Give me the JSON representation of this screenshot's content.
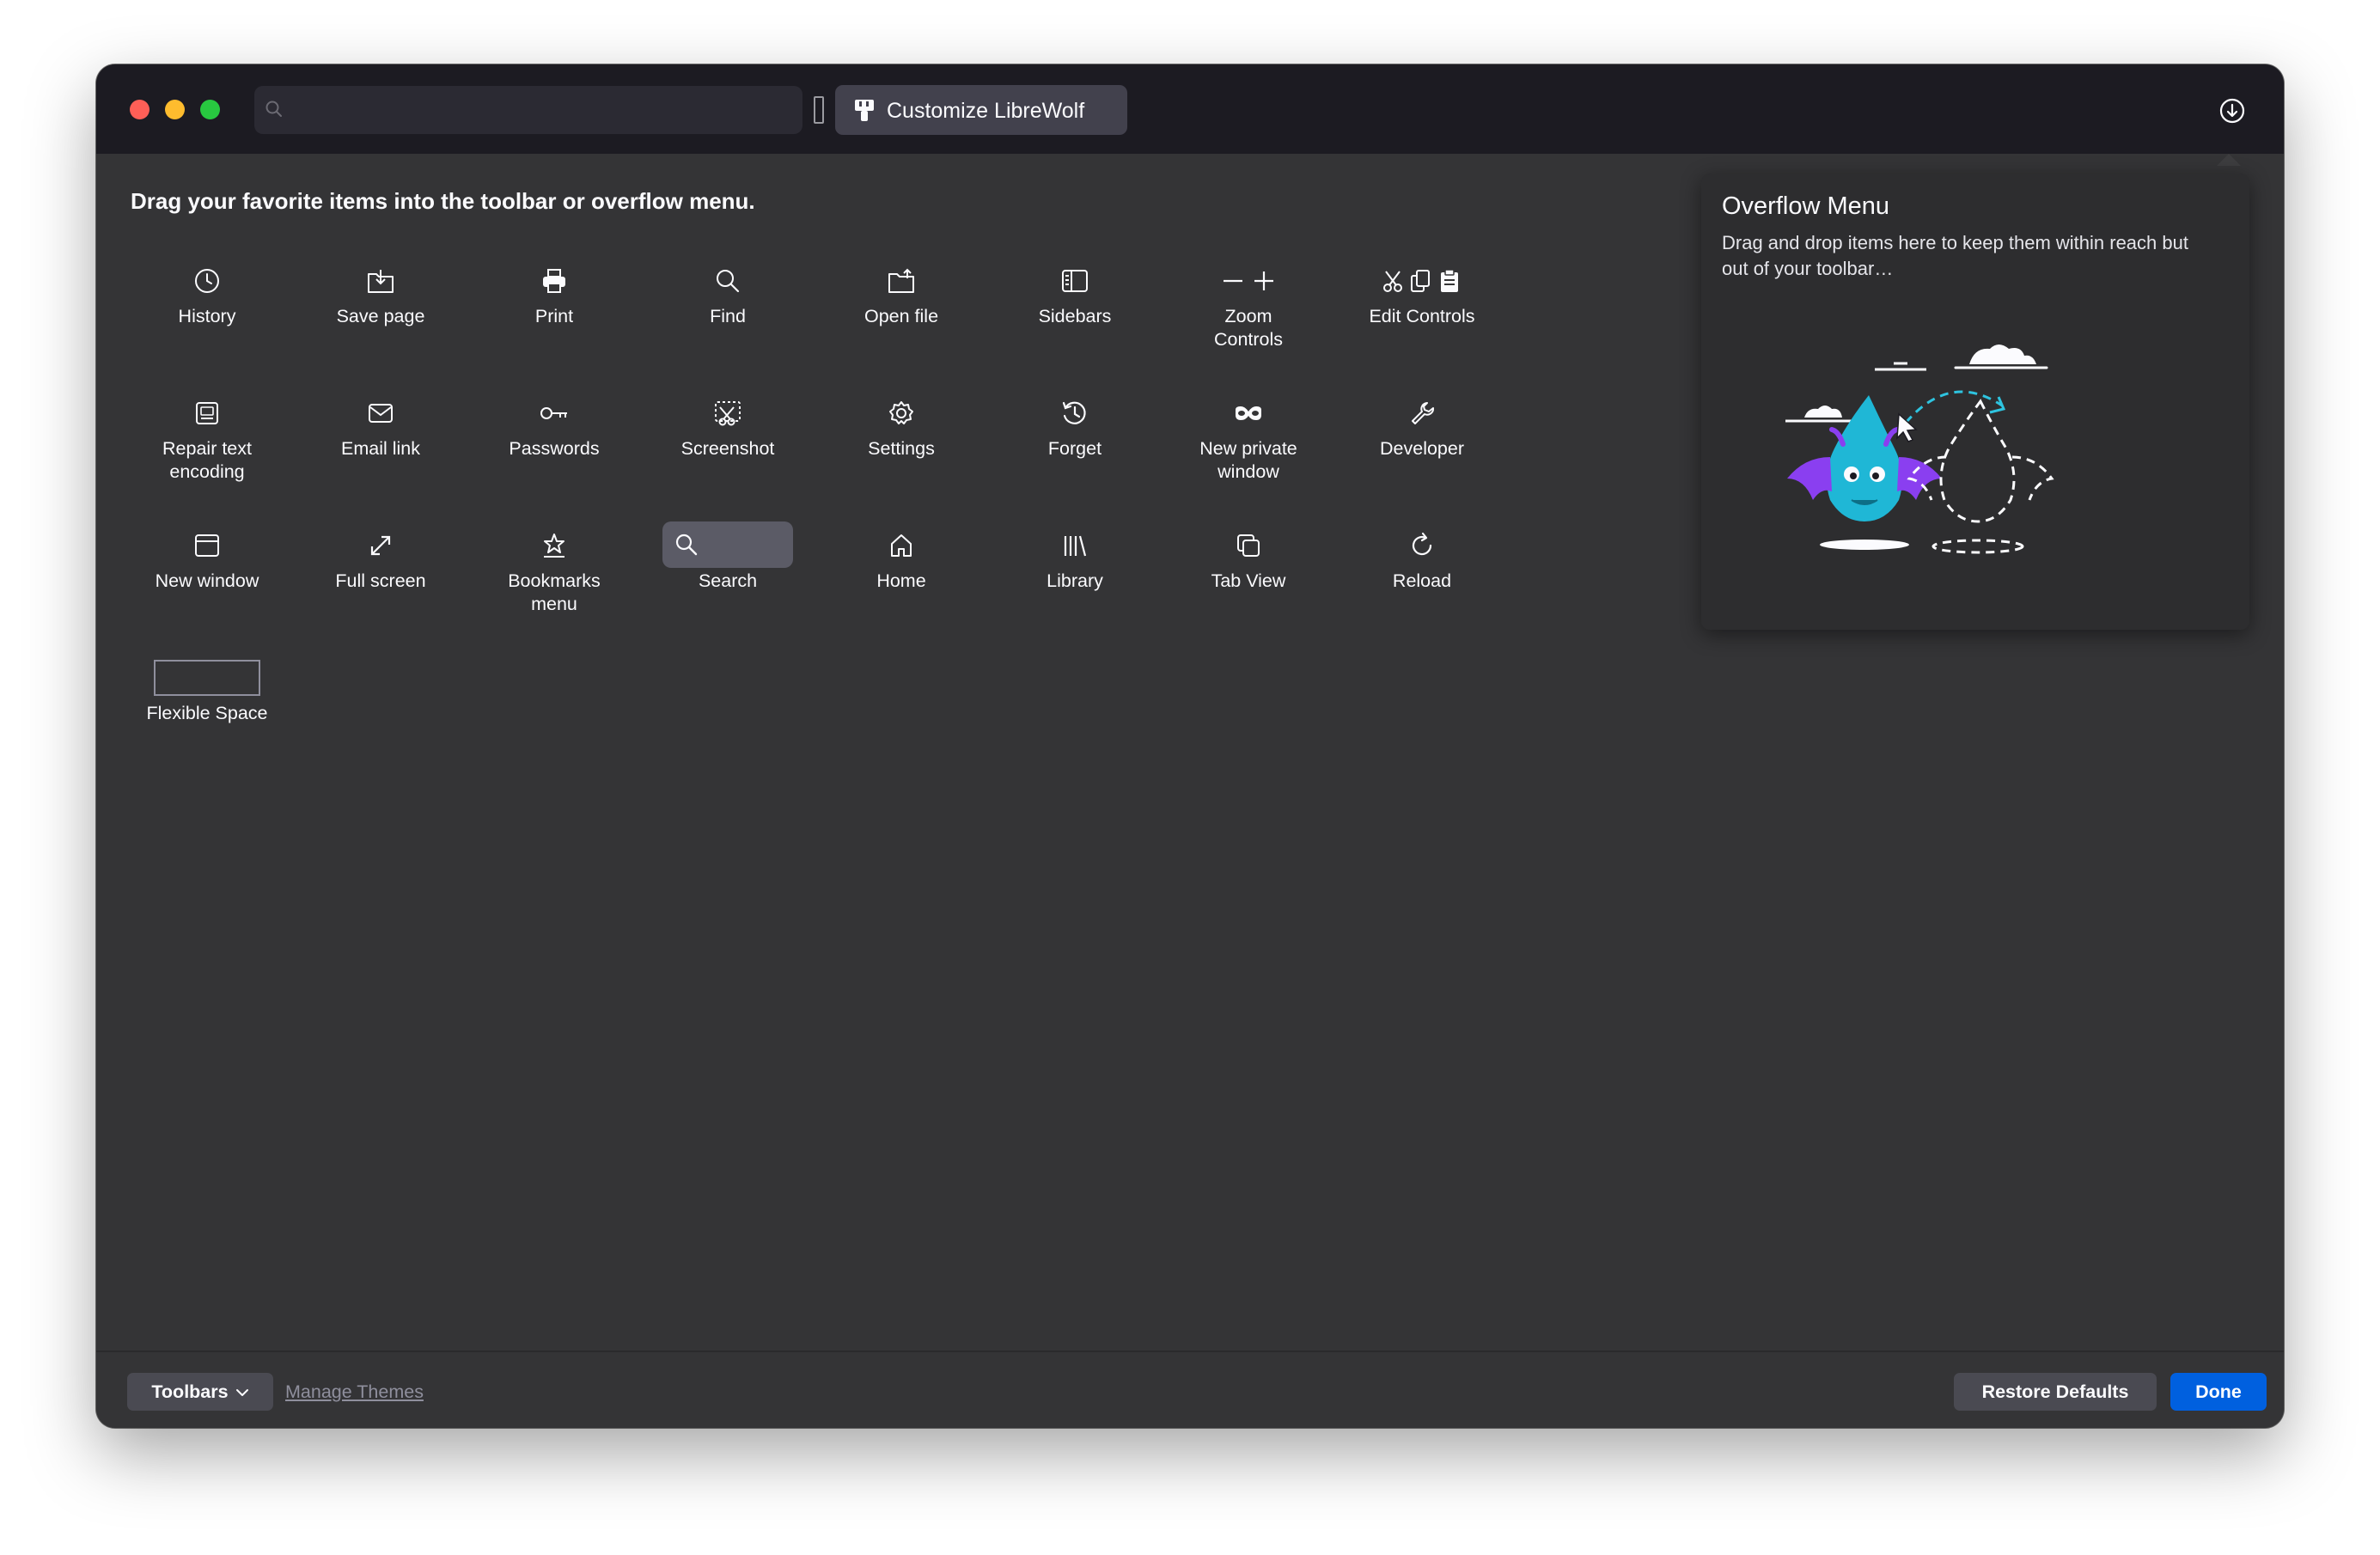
{
  "window": {
    "tab": {
      "title": "Customize LibreWolf",
      "icon": "customize-icon"
    },
    "url_bar": {
      "value": "",
      "icon": "search-icon"
    },
    "downloads_icon": "downloads-icon"
  },
  "customize": {
    "instructions": "Drag your favorite items into the toolbar or overflow menu.",
    "palette": [
      {
        "label": "History",
        "icon": "history-icon"
      },
      {
        "label": "Save page",
        "icon": "save-page-icon"
      },
      {
        "label": "Print",
        "icon": "print-icon"
      },
      {
        "label": "Find",
        "icon": "find-icon"
      },
      {
        "label": "Open file",
        "icon": "open-file-icon"
      },
      {
        "label": "Sidebars",
        "icon": "sidebars-icon"
      },
      {
        "label": "Zoom Controls",
        "icon": "zoom-controls-icon"
      },
      {
        "label": "Edit Controls",
        "icon": "edit-controls-icon"
      },
      {
        "label": "Repair text encoding",
        "icon": "text-encoding-icon"
      },
      {
        "label": "Email link",
        "icon": "email-icon"
      },
      {
        "label": "Passwords",
        "icon": "key-icon"
      },
      {
        "label": "Screenshot",
        "icon": "screenshot-icon"
      },
      {
        "label": "Settings",
        "icon": "gear-icon"
      },
      {
        "label": "Forget",
        "icon": "forget-icon"
      },
      {
        "label": "New private window",
        "icon": "private-browsing-icon"
      },
      {
        "label": "Developer",
        "icon": "wrench-icon"
      },
      {
        "label": "New window",
        "icon": "new-window-icon"
      },
      {
        "label": "Full screen",
        "icon": "fullscreen-icon"
      },
      {
        "label": "Bookmarks menu",
        "icon": "bookmarks-icon"
      },
      {
        "label": "Search",
        "icon": "search-icon"
      },
      {
        "label": "Home",
        "icon": "home-icon"
      },
      {
        "label": "Library",
        "icon": "library-icon"
      },
      {
        "label": "Tab View",
        "icon": "tab-view-icon"
      },
      {
        "label": "Reload",
        "icon": "reload-icon"
      },
      {
        "label": "Flexible Space",
        "icon": "flexible-space-placeholder"
      }
    ]
  },
  "overflow_menu": {
    "title": "Overflow Menu",
    "description": "Drag and drop items here to keep them within reach but out of your toolbar…"
  },
  "footer": {
    "toolbars_label": "Toolbars",
    "manage_themes_label": "Manage Themes",
    "restore_defaults_label": "Restore Defaults",
    "done_label": "Done"
  },
  "colors": {
    "background": "#343436",
    "titlebar": "#1c1b22",
    "text": "#fbfbfe",
    "accent": "#0060df"
  }
}
